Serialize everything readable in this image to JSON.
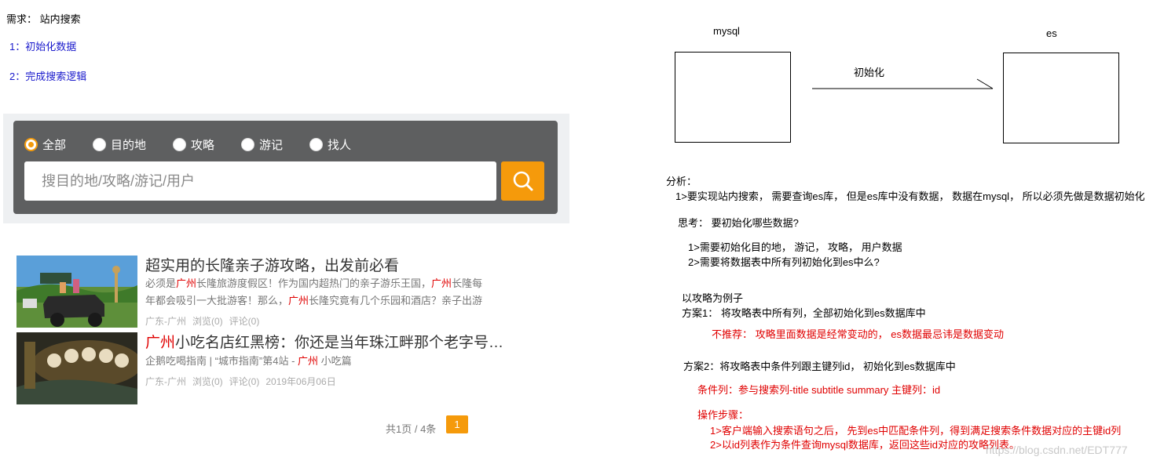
{
  "requirement": {
    "title": "需求： 站内搜索",
    "items": [
      "1：初始化数据",
      "2：完成搜索逻辑"
    ]
  },
  "search": {
    "tabs": [
      "全部",
      "目的地",
      "攻略",
      "游记",
      "找人"
    ],
    "active_tab": "全部",
    "placeholder": "搜目的地/攻略/游记/用户"
  },
  "articles": [
    {
      "title": "超实用的长隆亲子游攻略，出发前必看",
      "desc_parts": [
        "必须是",
        "广州",
        "长隆旅游度假区！作为国内超热门的亲子游乐王国，",
        "广州",
        "长隆每年都会吸引一大批游客！那么，",
        "广州",
        "长隆究竟有几个乐园和酒店？亲子出游"
      ],
      "meta": [
        "广东-广州",
        "浏览(0)",
        "评论(0)"
      ]
    },
    {
      "title_highlight": "广州",
      "title_rest": "小吃名店红黑榜：你还是当年珠江畔那个老字号…",
      "desc_parts": [
        "企鹅吃喝指南 | “城市指南”第4站 - ",
        "广州",
        " 小吃篇"
      ],
      "meta": [
        "广东-广州",
        "浏览(0)",
        "评论(0)",
        "2019年06月06日"
      ]
    }
  ],
  "pager": {
    "text": "共1页 / 4条",
    "current": "1"
  },
  "diagram": {
    "left_label": "mysql",
    "right_label": "es",
    "arrow_label": "初始化"
  },
  "analysis": {
    "title": "分析：",
    "point1": "1>要实现站内搜索， 需要查询es库， 但是es库中没有数据， 数据在mysql， 所以必须先做是数据初始化",
    "think_title": "思考： 要初始化哪些数据?",
    "think1": "1>需要初始化目的地， 游记， 攻略， 用户数据",
    "think2": "2>需要将数据表中所有列初始化到es中么?",
    "example": "以攻略为例子",
    "plan1": "方案1： 将攻略表中所有列，全部初始化到es数据库中",
    "plan1_note": "不推荐： 攻略里面数据是经常变动的， es数据最忌讳是数据变动",
    "plan2": "方案2：将攻略表中条件列跟主键列id， 初始化到es数据库中",
    "cond_cols": "条件列：参与搜索列-title  subtitle  summary  主键列：id",
    "steps_title": "操作步骤：",
    "step1": "1>客户端输入搜索语句之后， 先到es中匹配条件列，得到满足搜索条件数据对应的主键id列",
    "step2": "2>以id列表作为条件查询mysql数据库，返回这些id对应的攻略列表。"
  },
  "watermark": "https://blog.csdn.net/EDT777",
  "colors": {
    "accent": "#f59a0b",
    "panel": "#5e5f60",
    "highlight": "#e00000",
    "note_blue": "#1a1acc"
  }
}
